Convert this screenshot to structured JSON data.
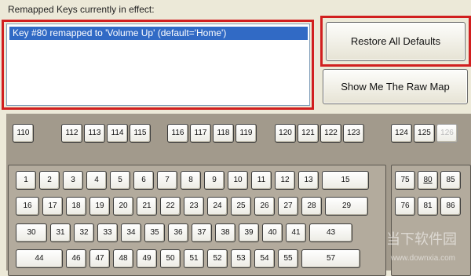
{
  "caption": "Remapped Keys currently in effect:",
  "remapped_list": [
    "Key #80 remapped to 'Volume Up' (default='Home')"
  ],
  "buttons": {
    "restore": "Restore All Defaults",
    "raw_map": "Show Me The Raw Map"
  },
  "keyboard": {
    "fn_rows": [
      [
        "110"
      ],
      [
        "112",
        "113",
        "114",
        "115"
      ],
      [
        "116",
        "117",
        "118",
        "119"
      ],
      [
        "120",
        "121",
        "122",
        "123"
      ],
      [
        "124",
        "125",
        "126"
      ]
    ],
    "main_rows": [
      [
        "1",
        "2",
        "3",
        "4",
        "5",
        "6",
        "7",
        "8",
        "9",
        "10",
        "11",
        "12",
        "13",
        "15"
      ],
      [
        "16",
        "17",
        "18",
        "19",
        "20",
        "21",
        "22",
        "23",
        "24",
        "25",
        "26",
        "27",
        "28",
        "29"
      ],
      [
        "30",
        "31",
        "32",
        "33",
        "34",
        "35",
        "36",
        "37",
        "38",
        "39",
        "40",
        "41",
        "43"
      ],
      [
        "44",
        "46",
        "47",
        "48",
        "49",
        "50",
        "51",
        "52",
        "53",
        "54",
        "55",
        "57"
      ]
    ],
    "nav_rows": [
      [
        "75",
        "80",
        "85"
      ],
      [
        "76",
        "81",
        "86"
      ]
    ],
    "disabled": [
      "126"
    ],
    "highlighted": [
      "80"
    ]
  },
  "watermark": {
    "main": "当下软件园",
    "sub": "www.downxia.com"
  },
  "colors": {
    "highlight_border": "#d11f1f",
    "selection": "#316ac5",
    "panel": "#a29a8c"
  }
}
